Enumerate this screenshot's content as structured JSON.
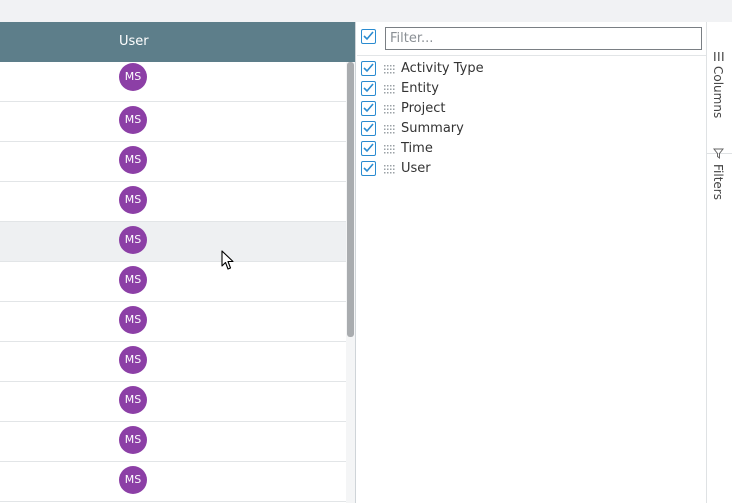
{
  "grid": {
    "column_header": "User",
    "rows": [
      {
        "avatar_initials": "MS"
      },
      {
        "avatar_initials": "MS"
      },
      {
        "avatar_initials": "MS"
      },
      {
        "avatar_initials": "MS"
      },
      {
        "avatar_initials": "MS"
      },
      {
        "avatar_initials": "MS"
      },
      {
        "avatar_initials": "MS"
      },
      {
        "avatar_initials": "MS"
      },
      {
        "avatar_initials": "MS"
      },
      {
        "avatar_initials": "MS"
      },
      {
        "avatar_initials": "MS"
      }
    ],
    "avatar_color": "#8c3fa6",
    "header_color": "#5d7e8a"
  },
  "columns_panel": {
    "filter_placeholder": "Filter...",
    "select_all_checked": true,
    "columns": [
      {
        "label": "Activity Type",
        "checked": true
      },
      {
        "label": "Entity",
        "checked": true
      },
      {
        "label": "Project",
        "checked": true
      },
      {
        "label": "Summary",
        "checked": true
      },
      {
        "label": "Time",
        "checked": true
      },
      {
        "label": "User",
        "checked": true
      }
    ]
  },
  "side_tabs": {
    "columns_label": "Columns",
    "columns_icon": "columns-icon",
    "filters_label": "Filters",
    "filters_icon": "filter-icon"
  }
}
